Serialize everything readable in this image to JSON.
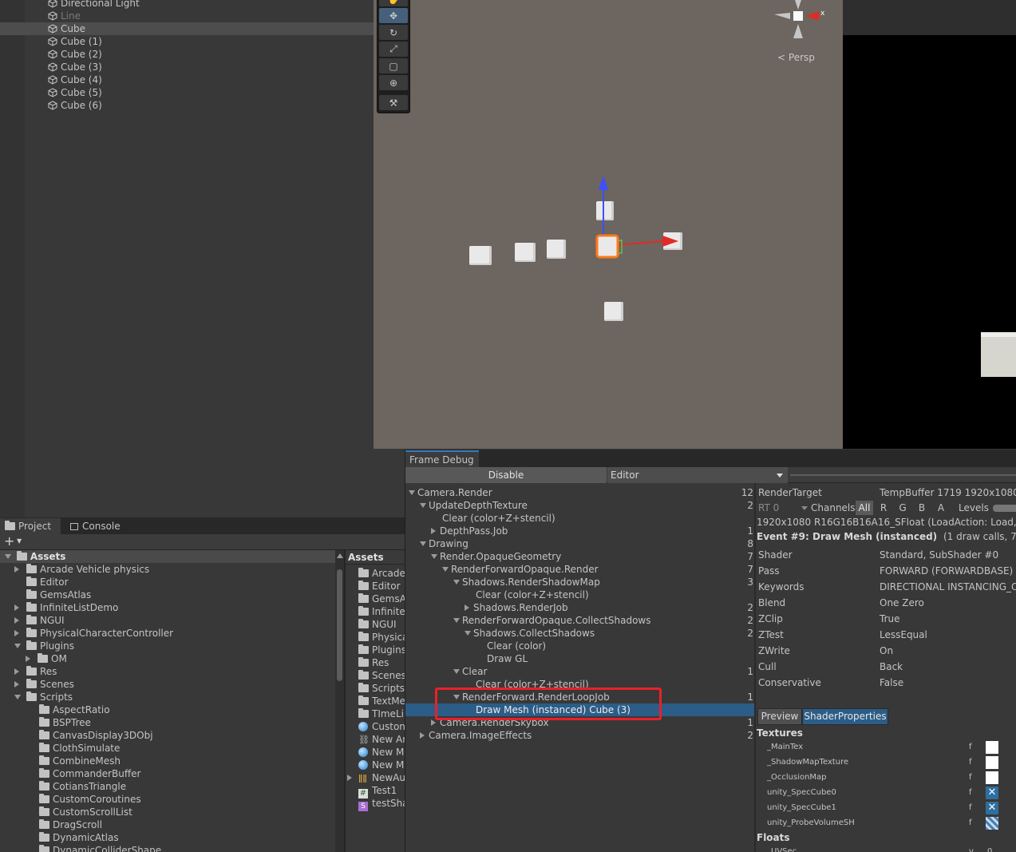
{
  "hierarchy": {
    "items": [
      {
        "label": "Directional Light",
        "dim": false,
        "selected": false
      },
      {
        "label": "Line",
        "dim": true,
        "selected": false
      },
      {
        "label": "Cube",
        "dim": false,
        "selected": true
      },
      {
        "label": "Cube (1)",
        "dim": false,
        "selected": false
      },
      {
        "label": "Cube (2)",
        "dim": false,
        "selected": false
      },
      {
        "label": "Cube (3)",
        "dim": false,
        "selected": false
      },
      {
        "label": "Cube (4)",
        "dim": false,
        "selected": false
      },
      {
        "label": "Cube (5)",
        "dim": false,
        "selected": false
      },
      {
        "label": "Cube (6)",
        "dim": false,
        "selected": false
      }
    ]
  },
  "scene": {
    "persp_label": "Persp",
    "gizmo_x": "x",
    "tools": [
      "hand-tool-icon",
      "move-tool-icon",
      "rotate-tool-icon",
      "scale-tool-icon",
      "rect-tool-icon",
      "transform-tool-icon",
      "custom-tool-icon"
    ]
  },
  "project": {
    "tabs": {
      "project": "Project",
      "console": "Console"
    },
    "add_label": "+",
    "tree_root": "Assets",
    "tree": [
      {
        "label": "Arcade Vehicle physics",
        "arrow": "right",
        "indent": 1
      },
      {
        "label": "Editor",
        "arrow": "",
        "indent": 1
      },
      {
        "label": "GemsAtlas",
        "arrow": "",
        "indent": 1
      },
      {
        "label": "InfiniteListDemo",
        "arrow": "right",
        "indent": 1
      },
      {
        "label": "NGUI",
        "arrow": "right",
        "indent": 1
      },
      {
        "label": "PhysicalCharacterController",
        "arrow": "right",
        "indent": 1
      },
      {
        "label": "Plugins",
        "arrow": "down",
        "indent": 1
      },
      {
        "label": "OM",
        "arrow": "right",
        "indent": 2
      },
      {
        "label": "Res",
        "arrow": "right",
        "indent": 1
      },
      {
        "label": "Scenes",
        "arrow": "right",
        "indent": 1
      },
      {
        "label": "Scripts",
        "arrow": "down",
        "indent": 1
      },
      {
        "label": "AspectRatio",
        "arrow": "",
        "indent": 2
      },
      {
        "label": "BSPTree",
        "arrow": "",
        "indent": 2
      },
      {
        "label": "CanvasDisplay3DObj",
        "arrow": "",
        "indent": 2
      },
      {
        "label": "ClothSimulate",
        "arrow": "",
        "indent": 2
      },
      {
        "label": "CombineMesh",
        "arrow": "",
        "indent": 2
      },
      {
        "label": "CommanderBuffer",
        "arrow": "",
        "indent": 2
      },
      {
        "label": "CotiansTriangle",
        "arrow": "",
        "indent": 2
      },
      {
        "label": "CustomCoroutines",
        "arrow": "",
        "indent": 2
      },
      {
        "label": "CustomScrollList",
        "arrow": "",
        "indent": 2
      },
      {
        "label": "DragScroll",
        "arrow": "",
        "indent": 2
      },
      {
        "label": "DynamicAtlas",
        "arrow": "",
        "indent": 2
      },
      {
        "label": "DynamicColliderShape",
        "arrow": "",
        "indent": 2
      }
    ],
    "assets_header": "Assets",
    "assets": [
      {
        "label": "Arcade",
        "icon": "folder"
      },
      {
        "label": "Editor",
        "icon": "folder"
      },
      {
        "label": "GemsA",
        "icon": "folder"
      },
      {
        "label": "Infinitel",
        "icon": "folder"
      },
      {
        "label": "NGUI",
        "icon": "folder"
      },
      {
        "label": "Physica",
        "icon": "folder"
      },
      {
        "label": "Plugins",
        "icon": "folder"
      },
      {
        "label": "Res",
        "icon": "folder"
      },
      {
        "label": "Scenes",
        "icon": "folder"
      },
      {
        "label": "Scripts",
        "icon": "folder"
      },
      {
        "label": "TextMe",
        "icon": "folder"
      },
      {
        "label": "TImeLi",
        "icon": "folder"
      },
      {
        "label": "Custon",
        "icon": "material"
      },
      {
        "label": "New Ar",
        "icon": "animator"
      },
      {
        "label": "New M",
        "icon": "material"
      },
      {
        "label": "New M",
        "icon": "material"
      },
      {
        "label": "NewAu",
        "icon": "audio-mixer"
      },
      {
        "label": "Test1",
        "icon": "script"
      },
      {
        "label": "testSha",
        "icon": "shader"
      }
    ]
  },
  "frame_debug": {
    "tab": "Frame Debug",
    "disable_button": "Disable",
    "target_dropdown": "Editor",
    "events": [
      {
        "label": "Camera.Render",
        "indent": 0,
        "arrow": "down",
        "count": "12"
      },
      {
        "label": "UpdateDepthTexture",
        "indent": 1,
        "arrow": "down",
        "count": "2"
      },
      {
        "label": "Clear (color+Z+stencil)",
        "indent": 2,
        "arrow": "",
        "count": ""
      },
      {
        "label": "DepthPass.Job",
        "indent": 2,
        "arrow": "right",
        "count": "1"
      },
      {
        "label": "Drawing",
        "indent": 1,
        "arrow": "down",
        "count": "8"
      },
      {
        "label": "Render.OpaqueGeometry",
        "indent": 2,
        "arrow": "down",
        "count": "7"
      },
      {
        "label": "RenderForwardOpaque.Render",
        "indent": 3,
        "arrow": "down",
        "count": "7"
      },
      {
        "label": "Shadows.RenderShadowMap",
        "indent": 4,
        "arrow": "down",
        "count": "3"
      },
      {
        "label": "Clear (color+Z+stencil)",
        "indent": 5,
        "arrow": "",
        "count": ""
      },
      {
        "label": "Shadows.RenderJob",
        "indent": 5,
        "arrow": "right",
        "count": "2"
      },
      {
        "label": "RenderForwardOpaque.CollectShadows",
        "indent": 4,
        "arrow": "down",
        "count": "2"
      },
      {
        "label": "Shadows.CollectShadows",
        "indent": 5,
        "arrow": "down",
        "count": "2"
      },
      {
        "label": "Clear (color)",
        "indent": 6,
        "arrow": "",
        "count": ""
      },
      {
        "label": "Draw GL",
        "indent": 6,
        "arrow": "",
        "count": ""
      },
      {
        "label": "Clear",
        "indent": 4,
        "arrow": "down",
        "count": "1"
      },
      {
        "label": "Clear (color+Z+stencil)",
        "indent": 5,
        "arrow": "",
        "count": ""
      },
      {
        "label": "RenderForward.RenderLoopJob",
        "indent": 4,
        "arrow": "down",
        "count": "1"
      },
      {
        "label": "Draw Mesh (instanced) Cube (3)",
        "indent": 5,
        "arrow": "",
        "count": "",
        "selected": true
      },
      {
        "label": "Camera.RenderSkybox",
        "indent": 2,
        "arrow": "right",
        "count": "1"
      },
      {
        "label": "Camera.ImageEffects",
        "indent": 1,
        "arrow": "right",
        "count": "2"
      }
    ],
    "render_target_label": "RenderTarget",
    "render_target_value": "TempBuffer 1719 1920x1080",
    "rt_dropdown": "RT 0",
    "channels_label": "Channels",
    "channels": [
      "All",
      "R",
      "G",
      "B",
      "A"
    ],
    "levels_label": "Levels",
    "format_line": "1920x1080 R16G16B16A16_SFloat (LoadAction: Load, Stor",
    "event_title": "Event #9: Draw Mesh (instanced)",
    "event_detail": "(1 draw calls, 7 instanc",
    "properties": [
      {
        "key": "Shader",
        "value": "Standard, SubShader #0"
      },
      {
        "key": "Pass",
        "value": "FORWARD (FORWARDBASE)"
      },
      {
        "key": "Keywords",
        "value": "DIRECTIONAL INSTANCING_O"
      },
      {
        "key": "Blend",
        "value": "One Zero"
      },
      {
        "key": "ZClip",
        "value": "True"
      },
      {
        "key": "ZTest",
        "value": "LessEqual"
      },
      {
        "key": "ZWrite",
        "value": "On"
      },
      {
        "key": "Cull",
        "value": "Back"
      },
      {
        "key": "Conservative",
        "value": "False"
      }
    ],
    "preview_tab": "Preview",
    "shader_props_tab": "ShaderProperties",
    "textures_header": "Textures",
    "textures": [
      {
        "name": "_MainTex",
        "stage": "f",
        "swatch": "white"
      },
      {
        "name": "_ShadowMapTexture",
        "stage": "f",
        "swatch": "white"
      },
      {
        "name": "_OcclusionMap",
        "stage": "f",
        "swatch": "white"
      },
      {
        "name": "unity_SpecCube0",
        "stage": "f",
        "swatch": "cube"
      },
      {
        "name": "unity_SpecCube1",
        "stage": "f",
        "swatch": "cube"
      },
      {
        "name": "unity_ProbeVolumeSH",
        "stage": "f",
        "swatch": "grid"
      }
    ],
    "floats_header": "Floats",
    "floats": [
      {
        "name": "_UVSec",
        "stage": "v",
        "value": "0"
      }
    ]
  },
  "colors": {
    "selection": "#2c5d87",
    "highlight_box": "#e8212b",
    "scene_bg": "#6c6560"
  }
}
